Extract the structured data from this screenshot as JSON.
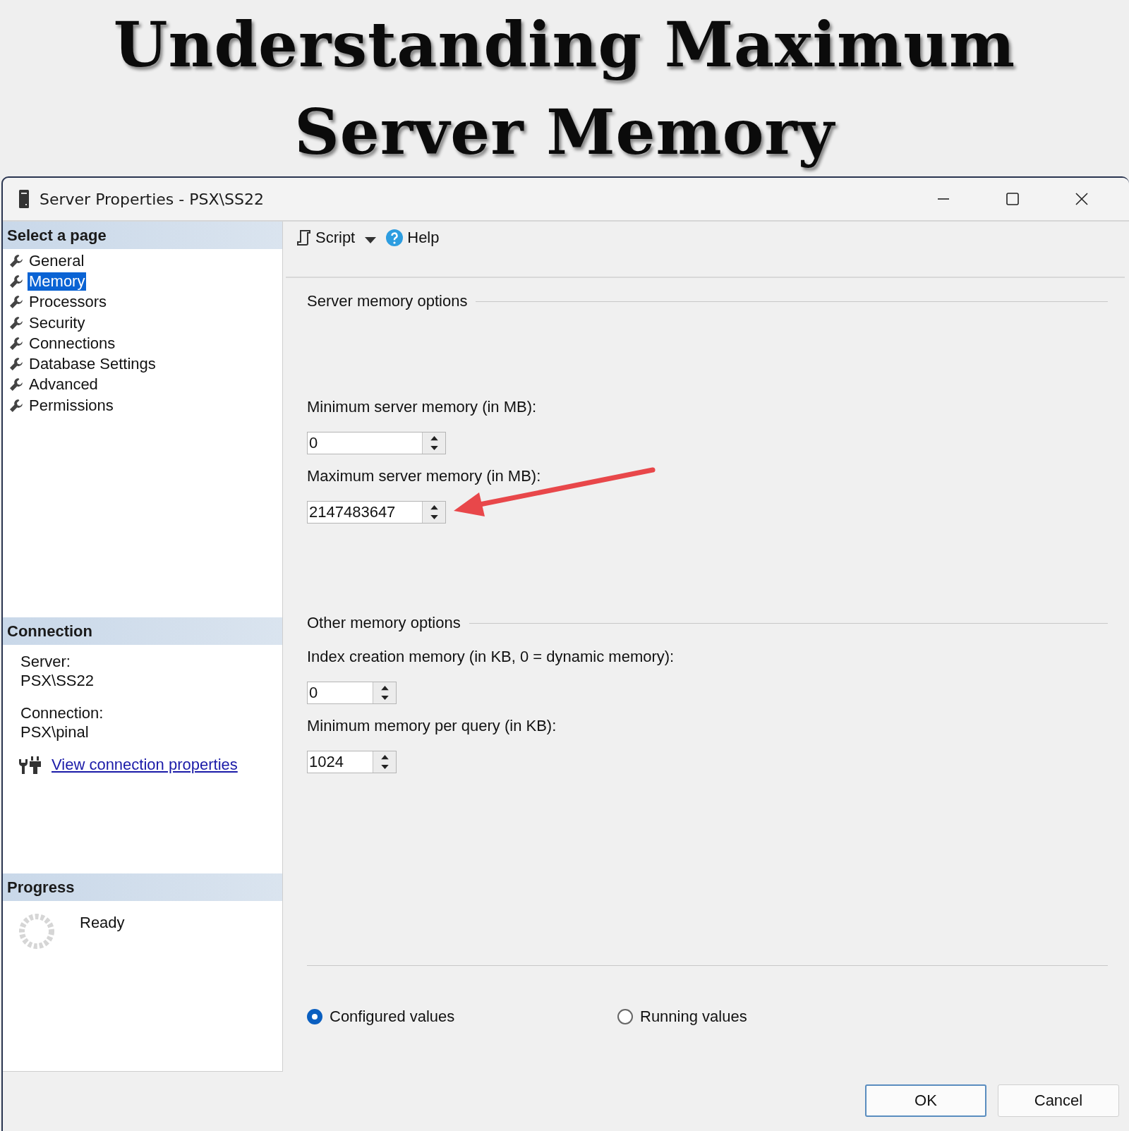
{
  "banner": {
    "title_lines": [
      "Understanding Maximum",
      "Server Memory"
    ]
  },
  "window": {
    "title": "Server Properties - PSX\\SS22"
  },
  "sidebar": {
    "header": "Select a page",
    "items": [
      {
        "label": "General",
        "selected": false
      },
      {
        "label": "Memory",
        "selected": true
      },
      {
        "label": "Processors",
        "selected": false
      },
      {
        "label": "Security",
        "selected": false
      },
      {
        "label": "Connections",
        "selected": false
      },
      {
        "label": "Database Settings",
        "selected": false
      },
      {
        "label": "Advanced",
        "selected": false
      },
      {
        "label": "Permissions",
        "selected": false
      }
    ]
  },
  "connection": {
    "header": "Connection",
    "fields": [
      {
        "label": "Server:",
        "value": "PSX\\SS22"
      },
      {
        "label": "Connection:",
        "value": "PSX\\pinal"
      }
    ],
    "link": "View connection properties"
  },
  "progress": {
    "header": "Progress",
    "status": "Ready"
  },
  "toolbar": {
    "script": "Script",
    "help": "Help"
  },
  "groups": [
    {
      "title": "Server memory options",
      "fields": [
        {
          "label": "Minimum server memory (in MB):",
          "value": "0",
          "annotated": false
        },
        {
          "label": "Maximum server memory (in MB):",
          "value": "2147483647",
          "annotated": true
        }
      ]
    },
    {
      "title": "Other memory options",
      "fields": [
        {
          "label": "Index creation memory (in KB, 0 = dynamic memory):",
          "value": "0",
          "annotated": false
        },
        {
          "label": "Minimum memory per query (in KB):",
          "value": "1024",
          "annotated": false
        }
      ]
    }
  ],
  "radios": [
    {
      "label": "Configured values",
      "selected": true
    },
    {
      "label": "Running values",
      "selected": false
    }
  ],
  "buttons": [
    {
      "label": "OK",
      "default": true
    },
    {
      "label": "Cancel",
      "default": false
    }
  ]
}
